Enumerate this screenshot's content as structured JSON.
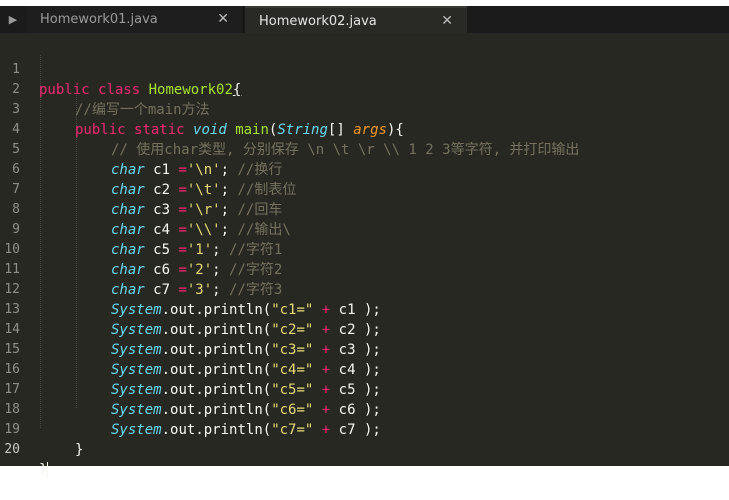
{
  "tabs": {
    "nav_arrow": "▶",
    "items": [
      {
        "label": "Homework01.java",
        "close": "✕"
      },
      {
        "label": "Homework02.java",
        "close": "✕"
      }
    ]
  },
  "editor": {
    "line_numbers": [
      "1",
      "2",
      "3",
      "4",
      "5",
      "6",
      "7",
      "8",
      "9",
      "10",
      "11",
      "12",
      "13",
      "14",
      "15",
      "16",
      "17",
      "18",
      "19",
      "20"
    ],
    "l1": {
      "public": "public",
      "class": "class",
      "name": "Homework02",
      "brace": "{"
    },
    "l2": {
      "comment": "//编写一个main方法"
    },
    "l3": {
      "public": "public",
      "static": "static",
      "void": "void",
      "main": "main",
      "lp": "(",
      "type": "String",
      "br": "[] ",
      "args": "args",
      "rp": "){"
    },
    "l4": {
      "comment": "// 使用char类型, 分别保存 \\n \\t \\r \\\\ 1 2 3等字符, 并打印输出"
    },
    "decls": [
      {
        "type": "char",
        "var": " c1 ",
        "eq": "=",
        "value": "'\\n'",
        "semi": ";",
        "comment": " //换行"
      },
      {
        "type": "char",
        "var": " c2 ",
        "eq": "=",
        "value": "'\\t'",
        "semi": ";",
        "comment": " //制表位"
      },
      {
        "type": "char",
        "var": " c3 ",
        "eq": "=",
        "value": "'\\r'",
        "semi": ";",
        "comment": " //回车"
      },
      {
        "type": "char",
        "var": " c4 ",
        "eq": "=",
        "value": "'\\\\'",
        "semi": ";",
        "comment": " //输出\\"
      },
      {
        "type": "char",
        "var": " c5 ",
        "eq": "=",
        "value": "'1'",
        "semi": ";",
        "comment": " //字符1"
      },
      {
        "type": "char",
        "var": " c6 ",
        "eq": "=",
        "value": "'2'",
        "semi": ";",
        "comment": " //字符2"
      },
      {
        "type": "char",
        "var": " c7 ",
        "eq": "=",
        "value": "'3'",
        "semi": ";",
        "comment": " //字符3"
      }
    ],
    "prints": [
      {
        "sys": "System",
        "dot1": ".",
        "out": "out",
        "dot2": ".",
        "fn": "println",
        "lp": "(",
        "str": "\"c1=\"",
        "plus": " + ",
        "var": "c1 ",
        "rp": ");"
      },
      {
        "sys": "System",
        "dot1": ".",
        "out": "out",
        "dot2": ".",
        "fn": "println",
        "lp": "(",
        "str": "\"c2=\"",
        "plus": " + ",
        "var": "c2 ",
        "rp": ");"
      },
      {
        "sys": "System",
        "dot1": ".",
        "out": "out",
        "dot2": ".",
        "fn": "println",
        "lp": "(",
        "str": "\"c3=\"",
        "plus": " + ",
        "var": "c3 ",
        "rp": ");"
      },
      {
        "sys": "System",
        "dot1": ".",
        "out": "out",
        "dot2": ".",
        "fn": "println",
        "lp": "(",
        "str": "\"c4=\"",
        "plus": " + ",
        "var": "c4 ",
        "rp": ");"
      },
      {
        "sys": "System",
        "dot1": ".",
        "out": "out",
        "dot2": ".",
        "fn": "println",
        "lp": "(",
        "str": "\"c5=\"",
        "plus": " + ",
        "var": "c5 ",
        "rp": ");"
      },
      {
        "sys": "System",
        "dot1": ".",
        "out": "out",
        "dot2": ".",
        "fn": "println",
        "lp": "(",
        "str": "\"c6=\"",
        "plus": " + ",
        "var": "c6 ",
        "rp": ");"
      },
      {
        "sys": "System",
        "dot1": ".",
        "out": "out",
        "dot2": ".",
        "fn": "println",
        "lp": "(",
        "str": "\"c7=\"",
        "plus": " + ",
        "var": "c7 ",
        "rp": ");"
      }
    ],
    "l19": {
      "brace": "}"
    },
    "l20": {
      "brace": "}"
    }
  },
  "colors": {
    "background": "#272822",
    "keyword": "#f92672",
    "storage": "#66d9ef",
    "function": "#a6e22e",
    "comment": "#75715e",
    "string": "#e6db74",
    "constant": "#ae81ff",
    "parameter": "#fd971f"
  }
}
